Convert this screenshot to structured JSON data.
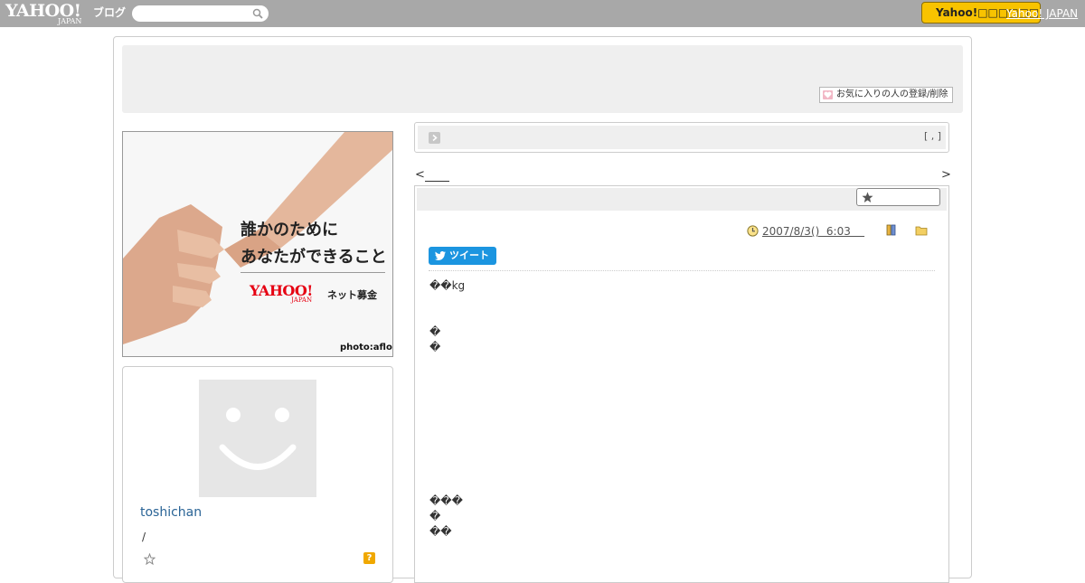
{
  "topbar": {
    "logo_text": "YAHOO!",
    "logo_sub": "JAPAN",
    "logo_blog": "ブログ",
    "search_placeholder": "",
    "yahoo_button": "Yahoo!□□□□□□",
    "yahoo_japan_link": "Yahoo! JAPAN"
  },
  "header": {
    "favorite_button": "お気に入りの人の登録/削除"
  },
  "banner": {
    "line1": "誰かのために",
    "line2": "あなたができること",
    "logo": "YAHOO!",
    "logo_sub": "JAPAN",
    "tagline": "ネット募金",
    "credit": "photo:aflo"
  },
  "profile": {
    "username": "toshichan",
    "slash": "/",
    "help": "?"
  },
  "title_box": {
    "bracket": "[ , ]"
  },
  "nav": {
    "prev": "<",
    "next": ">"
  },
  "article": {
    "date": "2007/8/3()  6:03    ",
    "tweet_label": "ツイート",
    "lines": [
      {
        "text": "��kg"
      },
      {
        "text": "�"
      },
      {
        "text": "�"
      },
      {
        "text": "���"
      },
      {
        "text": "�"
      },
      {
        "text": "��"
      }
    ]
  },
  "colors": {
    "topbar": "#a8a8a8",
    "yahoo_button": "#f8c300",
    "tweet": "#1b95e0",
    "link": "#2a6496"
  }
}
